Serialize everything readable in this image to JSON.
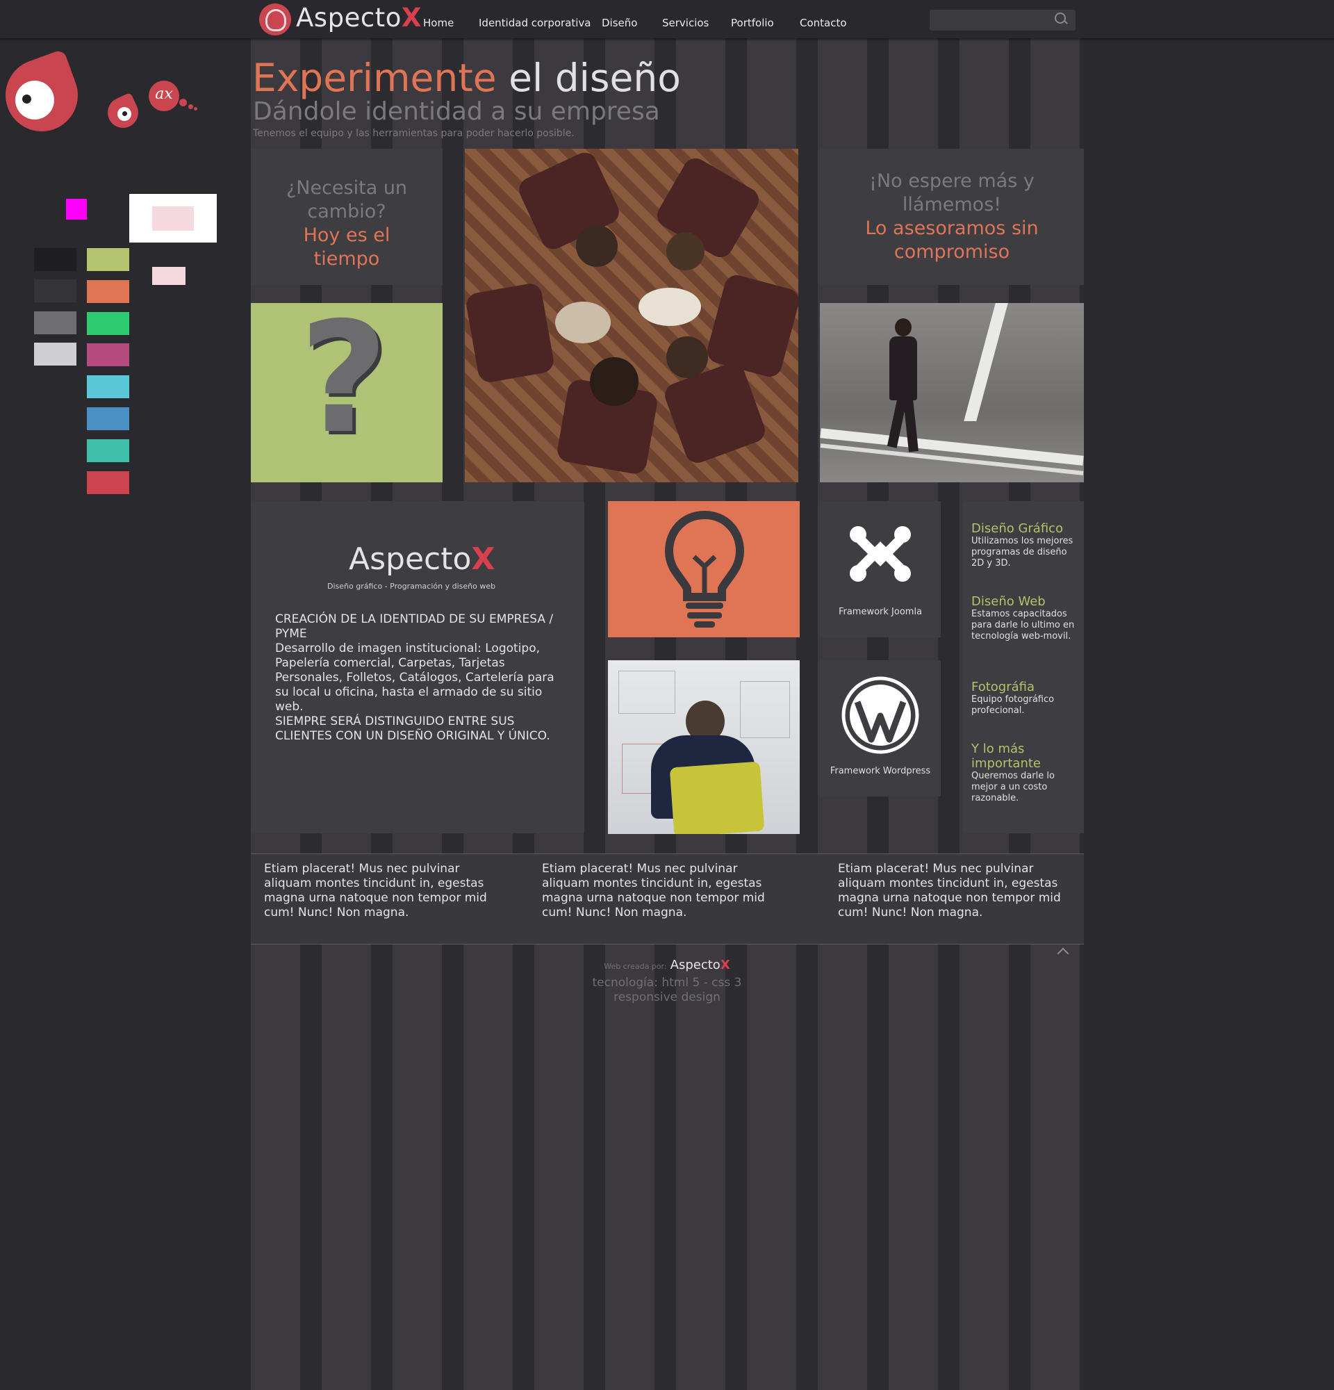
{
  "brand": {
    "name": "Aspecto",
    "x": "X"
  },
  "nav": [
    "Home",
    "Identidad corporativa",
    "Diseño",
    "Servicios",
    "Portfolio",
    "Contacto"
  ],
  "search": {
    "placeholder": ""
  },
  "decoration": {
    "bubble_text": "ax"
  },
  "palette": {
    "grays": [
      "#1f1f22",
      "#343438",
      "#6e6e71",
      "#cfcfd2"
    ],
    "colors": [
      "#b5c46f",
      "#e07556",
      "#2ecc71",
      "#b54b7f",
      "#5ac8d8",
      "#4a90c4",
      "#3fbfaa",
      "#cc4450"
    ],
    "magenta": "#ff00ff",
    "pink": "#f6d9de"
  },
  "hero": {
    "title_accent": "Experimente",
    "title_rest": " el diseño",
    "subtitle": "Dándole identidad a su empresa",
    "tagline": "Tenemos el equipo y las herramientas para poder hacerlo posible."
  },
  "box_change": {
    "line1": "¿Necesita un cambio?",
    "line2": "Hoy es el tiempo"
  },
  "box_call": {
    "line1": "¡No espere más y llámemos!",
    "line2": "Lo asesoramos sin compromiso"
  },
  "question": {
    "symbol": "?"
  },
  "card": {
    "brand": "Aspecto",
    "brand_x": "X",
    "tagline": "Diseño gráfico - Programación y diseño web",
    "heading": "CREACIÓN DE LA IDENTIDAD DE SU EMPRESA / PYME",
    "body": "Desarrollo de imagen institucional: Logotipo, Papelería comercial, Carpetas, Tarjetas Personales, Folletos, Catálogos, Cartelería para su local u oficina, hasta el armado de su sitio web.",
    "closing": "SIEMPRE SERÁ DISTINGUIDO ENTRE SUS CLIENTES CON UN DISEÑO ORIGINAL Y ÚNICO."
  },
  "frameworks": {
    "joomla": "Framework Joomla",
    "wordpress": "Framework Wordpress"
  },
  "services": [
    {
      "title": "Diseño Gráfico",
      "desc": "Utilizamos los mejores programas de diseño 2D y 3D."
    },
    {
      "title": "Diseño Web",
      "desc": "Estamos capacitados para darle lo ultimo en tecnología web-movil."
    },
    {
      "title": "Fotográfia",
      "desc": "Equipo fotográfico profecional."
    },
    {
      "title": "Y lo más importante",
      "desc": "Queremos darle lo mejor a un costo razonable."
    }
  ],
  "footer": {
    "columns": [
      "Etiam placerat! Mus nec pulvinar aliquam montes tincidunt in, egestas magna urna natoque non tempor mid cum! Nunc! Non magna.",
      "Etiam placerat! Mus nec pulvinar aliquam montes tincidunt in, egestas magna urna natoque non tempor mid cum! Nunc! Non magna.",
      "Etiam placerat! Mus nec pulvinar aliquam montes tincidunt in, egestas magna urna natoque non tempor mid cum! Nunc! Non magna."
    ],
    "credit_label": "Web creada por:",
    "credit_brand": "Aspecto",
    "credit_x": "X",
    "tech": "tecnología: html 5 - css 3",
    "responsive": "responsive design"
  }
}
